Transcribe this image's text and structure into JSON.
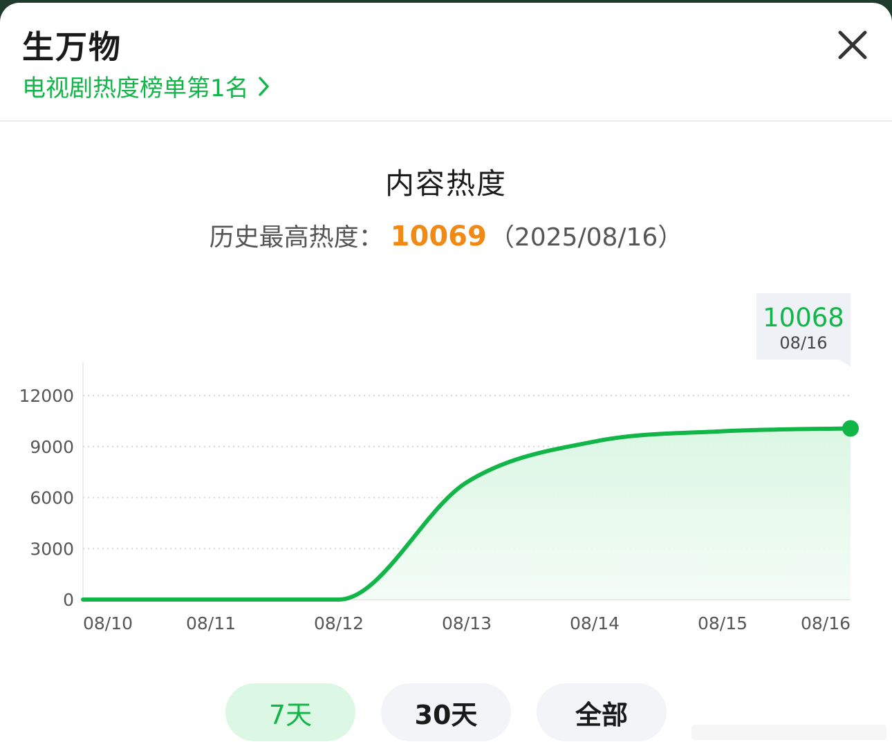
{
  "header": {
    "title": "生万物",
    "rank_link": "电视剧热度榜单第1名"
  },
  "chart_header": {
    "title": "内容热度",
    "record_label": "历史最高热度：",
    "record_value": "10069",
    "record_date": "（2025/08/16）"
  },
  "tooltip": {
    "value": "10068",
    "date": "08/16"
  },
  "tabs": [
    {
      "label": "7天",
      "active": true
    },
    {
      "label": "30天",
      "active": false
    },
    {
      "label": "全部",
      "active": false
    }
  ],
  "colors": {
    "accent": "#12b548",
    "peak": "#f08a14",
    "fill": "#e4f8ea"
  },
  "chart_data": {
    "type": "area",
    "title": "内容热度",
    "x": [
      "08/10",
      "08/11",
      "08/12",
      "08/13",
      "08/14",
      "08/15",
      "08/16"
    ],
    "series": [
      {
        "values": [
          0,
          0,
          0,
          6900,
          9300,
          9900,
          10068
        ]
      }
    ],
    "yticks": [
      0,
      3000,
      6000,
      9000,
      12000
    ],
    "ylim": [
      0,
      12000
    ],
    "grid": true,
    "highlight": {
      "x": "08/16",
      "value": 10068
    }
  }
}
